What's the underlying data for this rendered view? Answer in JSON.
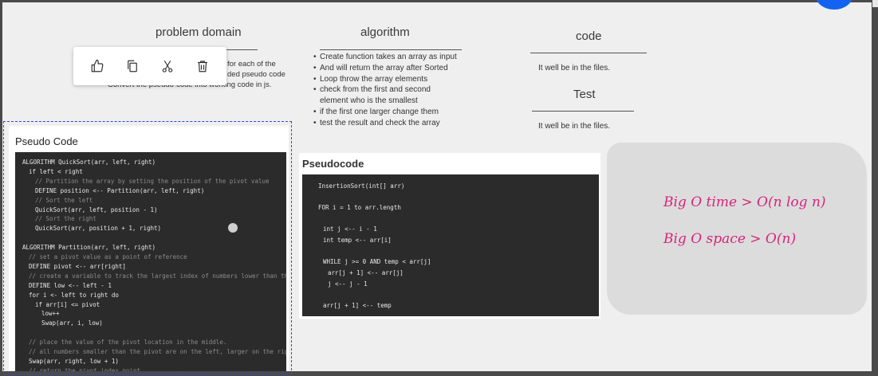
{
  "headings": {
    "problem_domain": "problem domain",
    "algorithm": "algorithm",
    "code": "code",
    "test": "Test"
  },
  "problem_domain": {
    "line1": "for each of the",
    "line2": "ded pseudo code",
    "line3": "Convert the pseudo-code into working code in js."
  },
  "algorithm_items": [
    {
      "text": "Create function takes an array as input",
      "bullet": true
    },
    {
      "text": "And will return the array after Sorted",
      "bullet": true
    },
    {
      "text": "Loop throw the array elements",
      "bullet": true
    },
    {
      "text": "check from the first and second",
      "bullet": true
    },
    {
      "text": "element who is the smallest",
      "bullet": false
    },
    {
      "text": "if the first one larger change them",
      "bullet": true
    },
    {
      "text": "test the result and check the array",
      "bullet": true
    }
  ],
  "code_note": "It well be in the files.",
  "test_note": "It well be in the files.",
  "toolbar": {
    "icons": [
      "thumbs-up-icon",
      "copy-icon",
      "cut-icon",
      "trash-icon"
    ]
  },
  "quicksort_card": {
    "title": "Pseudo Code",
    "lines": [
      {
        "t": "ALGORITHM QuickSort(arr, left, right)",
        "c": "",
        "i": 0
      },
      {
        "t": "if left < right",
        "c": "",
        "i": 1
      },
      {
        "t": "// Partition the array by setting the position of the pivot value",
        "c": "c-cmt",
        "i": 2
      },
      {
        "t": "DEFINE position <-- Partition(arr, left, right)",
        "c": "",
        "i": 2
      },
      {
        "t": "// Sort the left",
        "c": "c-cmt",
        "i": 2
      },
      {
        "t": "QuickSort(arr, left, position - 1)",
        "c": "",
        "i": 2
      },
      {
        "t": "// Sort the right",
        "c": "c-cmt",
        "i": 2
      },
      {
        "t": "QuickSort(arr, position + 1, right)",
        "c": "",
        "i": 2
      },
      {
        "t": "",
        "c": "",
        "i": 0
      },
      {
        "t": "ALGORITHM Partition(arr, left, right)",
        "c": "",
        "i": 0
      },
      {
        "t": "// set a pivot value as a point of reference",
        "c": "c-cmt",
        "i": 1
      },
      {
        "t": "DEFINE pivot <-- arr[right]",
        "c": "",
        "i": 1
      },
      {
        "t": "// create a variable to track the largest index of numbers lower than the defined pivot",
        "c": "c-cmt",
        "i": 1
      },
      {
        "t": "DEFINE low <-- left - 1",
        "c": "",
        "i": 1
      },
      {
        "t": "for i <- left to right do",
        "c": "",
        "i": 1
      },
      {
        "t": "if arr[i] <= pivot",
        "c": "",
        "i": 2
      },
      {
        "t": "low++",
        "c": "",
        "i": 3
      },
      {
        "t": "Swap(arr, i, low)",
        "c": "",
        "i": 3
      },
      {
        "t": "",
        "c": "",
        "i": 0
      },
      {
        "t": "// place the value of the pivot location in the middle.",
        "c": "c-cmt",
        "i": 1
      },
      {
        "t": "// all numbers smaller than the pivot are on the left, larger on the right.",
        "c": "c-cmt",
        "i": 1
      },
      {
        "t": "Swap(arr, right, low + 1)",
        "c": "",
        "i": 1
      },
      {
        "t": "// return the pivot index point",
        "c": "c-cmt",
        "i": 1
      }
    ]
  },
  "insertion_card": {
    "title": "Pseudocode",
    "lines": [
      {
        "t": "InsertionSort(int[] arr)",
        "gap": 0,
        "i": 0
      },
      {
        "t": "FOR i = 1 to arr.length",
        "gap": 1,
        "i": 0
      },
      {
        "t": "int j <-- i - 1",
        "gap": 1,
        "i": 1
      },
      {
        "t": "int temp <-- arr[i]",
        "gap": 0,
        "i": 1
      },
      {
        "t": "WHILE j >= 0 AND temp < arr[j]",
        "gap": 1,
        "i": 1
      },
      {
        "t": "arr[j + 1] <-- arr[j]",
        "gap": 0,
        "i": 2
      },
      {
        "t": "j <-- j - 1",
        "gap": 0,
        "i": 2
      },
      {
        "t": "arr[j + 1] <-- temp",
        "gap": 1,
        "i": 1
      }
    ]
  },
  "notes": {
    "time": "Big O time > O(n log n)",
    "space": "Big O space > O(n)"
  },
  "colors": {
    "selection": "#2a4be0",
    "handwriting": "#d6247a",
    "accent_dot": "#1463f0"
  }
}
